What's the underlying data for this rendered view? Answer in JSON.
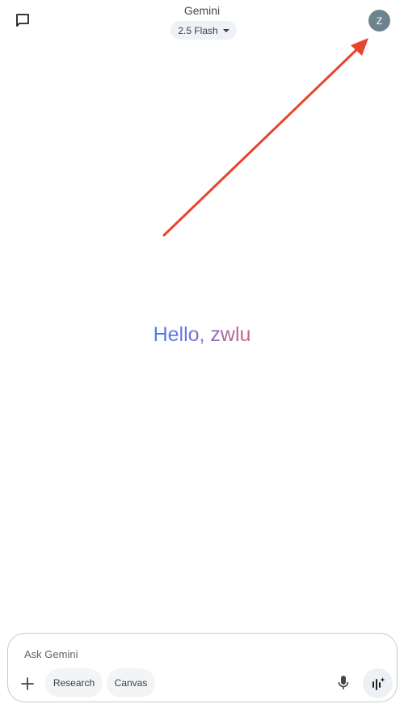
{
  "header": {
    "title": "Gemini",
    "model_selector": {
      "label": "2.5 Flash"
    },
    "avatar_initial": "Z",
    "chat_icon": "chat-bubble-icon",
    "avatar_color": "#6f838f"
  },
  "annotation": {
    "arrow_color": "#e8452f"
  },
  "main": {
    "greeting": "Hello, zwlu",
    "greeting_colors": [
      "#4a80e8",
      "#7a6fd0",
      "#d0647e"
    ]
  },
  "composer": {
    "placeholder": "Ask Gemini",
    "value": "",
    "chips": [
      {
        "label": "Research"
      },
      {
        "label": "Canvas"
      }
    ],
    "icons": {
      "add": "plus-icon",
      "mic": "microphone-icon",
      "live": "audio-waveform-sparkle-icon"
    }
  }
}
